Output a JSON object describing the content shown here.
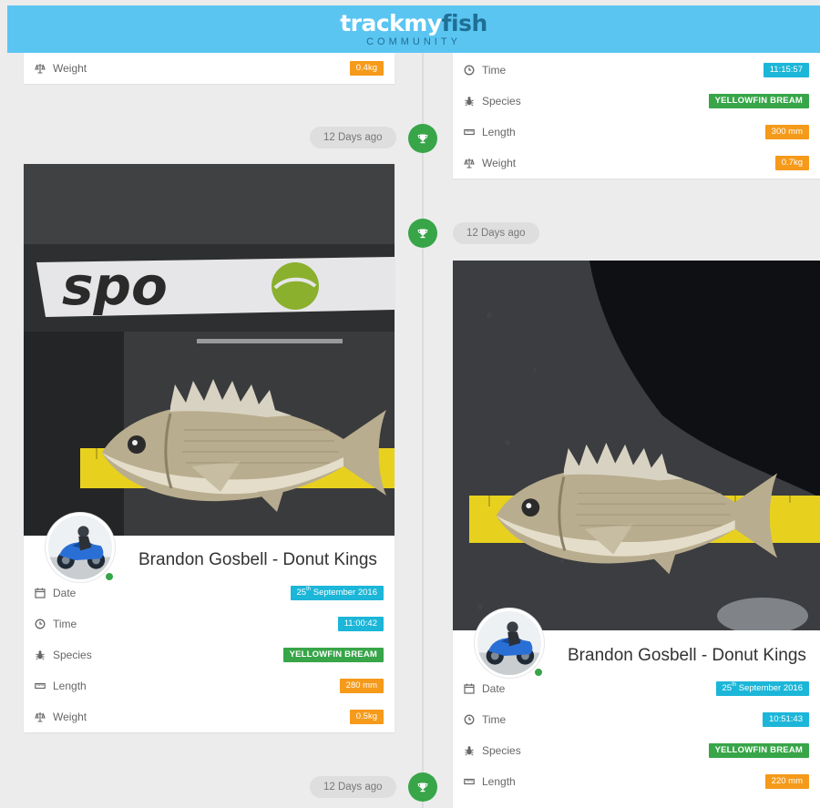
{
  "header": {
    "logo_main_a": "trackmy",
    "logo_main_b": "fish",
    "logo_sub": "COMMUNITY"
  },
  "colors": {
    "header_bg": "#5bc5f2",
    "accent_cyan": "#1cb6d8",
    "species_green": "#37a548",
    "measure_orange": "#f59a1a"
  },
  "timeline": {
    "pill_1": "12 Days ago",
    "pill_2": "12 Days ago",
    "pill_3": "12 Days ago"
  },
  "labels": {
    "date": "Date",
    "time": "Time",
    "species": "Species",
    "length": "Length",
    "weight": "Weight"
  },
  "icons": {
    "date": "calendar-icon",
    "time": "clock-icon",
    "species": "bug-icon",
    "length": "ruler-icon",
    "weight": "weight-icon",
    "timeline": "trophy-icon"
  },
  "posts": {
    "left_top": {
      "weight": "0.4kg"
    },
    "right_top": {
      "time": "11:15:57",
      "species": "YELLOWFIN BREAM",
      "length": "300 mm",
      "weight": "0.7kg"
    },
    "left_main": {
      "author": "Brandon Gosbell - Donut Kings",
      "date_day": "25",
      "date_suffix": "th",
      "date_rest": " September 2016",
      "time": "11:00:42",
      "species": "YELLOWFIN BREAM",
      "length": "280 mm",
      "weight": "0.5kg",
      "photo_brand": "spo"
    },
    "right_main": {
      "author": "Brandon Gosbell - Donut Kings",
      "date_day": "25",
      "date_suffix": "th",
      "date_rest": " September 2016",
      "time": "10:51:43",
      "species": "YELLOWFIN BREAM",
      "length": "220 mm"
    }
  }
}
